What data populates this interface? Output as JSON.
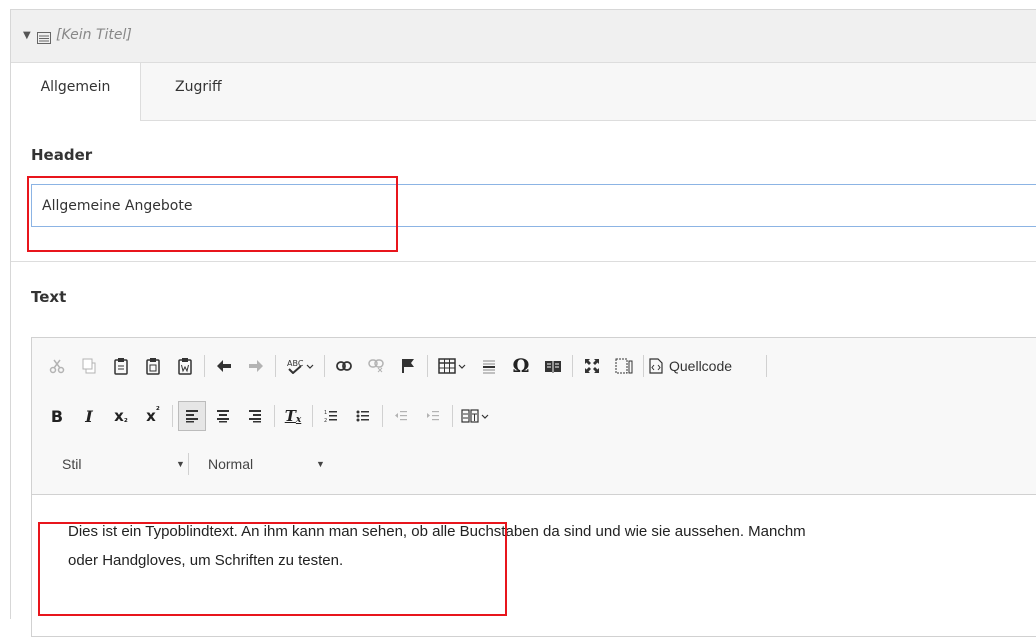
{
  "record": {
    "title": "[Kein Titel]"
  },
  "tabs": [
    {
      "label": "Allgemein",
      "active": true
    },
    {
      "label": "Zugriff",
      "active": false
    }
  ],
  "header_field": {
    "label": "Header",
    "value": "Allgemeine Angebote"
  },
  "text_field": {
    "label": "Text",
    "toolbar": {
      "row1": [
        "cut-icon",
        "copy-icon",
        "paste-icon",
        "paste-text-icon",
        "paste-word-icon",
        "undo-icon",
        "redo-icon",
        "spellcheck-icon",
        "link-icon",
        "unlink-icon",
        "anchor-icon",
        "table-icon",
        "horizontal-line-icon",
        "special-char-icon",
        "about-icon",
        "maximize-icon",
        "show-blocks-icon",
        "source-icon"
      ],
      "source_label": "Quellcode",
      "row2": [
        "bold",
        "italic",
        "subscript",
        "superscript",
        "align-left",
        "align-center",
        "align-right",
        "remove-format",
        "numbered-list",
        "bulleted-list",
        "outdent",
        "indent",
        "language"
      ],
      "style_combo": "Stil",
      "format_combo": "Normal"
    },
    "content_line1": "Dies ist ein Typoblindtext. An ihm kann man sehen, ob alle Buchstaben da sind und wie sie aussehen. Manchm",
    "content_line2": "oder Handgloves, um Schriften zu testen."
  },
  "colors": {
    "highlight": "#e8151c",
    "input_focus_border": "#8cb4e4",
    "header_bg": "#f0f0f0"
  }
}
